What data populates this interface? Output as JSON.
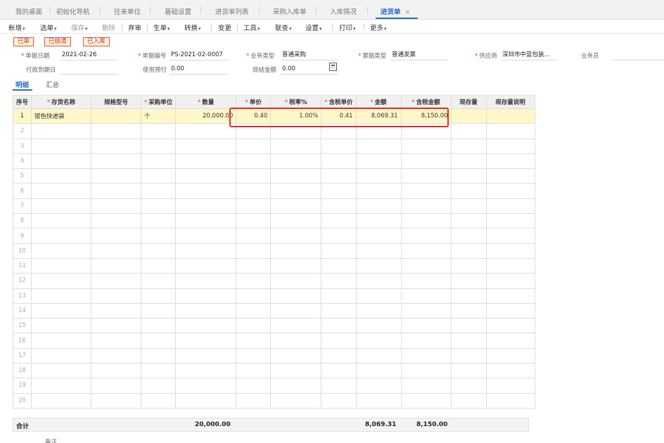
{
  "tabs": [
    {
      "label": "我的桌面"
    },
    {
      "label": "初始化导航"
    },
    {
      "label": "往来单位"
    },
    {
      "label": "基础设置"
    },
    {
      "label": "进货单列表"
    },
    {
      "label": "采购入库单"
    },
    {
      "label": "入库情况"
    },
    {
      "label": "进货单",
      "close": "×"
    }
  ],
  "toolbar": {
    "add": "新增",
    "select": "选单",
    "save": "保存",
    "delete": "删除",
    "discard": "弃审",
    "generate": "生单",
    "convert": "转换",
    "change": "变更",
    "tools": "工具",
    "query": "联查",
    "settings": "设置",
    "print": "打印",
    "more": "更多"
  },
  "status_badges": [
    "已审",
    "已结清",
    "已入库"
  ],
  "header": {
    "doc_date_label": "单据日期",
    "doc_date": "2021-02-26",
    "doc_no_label": "单据编号",
    "doc_no": "PS-2021-02-0007",
    "biz_type_label": "业务类型",
    "biz_type": "普通采购",
    "invoice_type_label": "票据类型",
    "invoice_type": "普通发票",
    "supplier_label": "供应商",
    "supplier": "深圳市中蓝包装...",
    "salesman_label": "业务员",
    "salesman": "",
    "due_date_label": "付款到期日",
    "due_date": "",
    "prepay_label": "使用预付",
    "prepay": "0.00",
    "cash_label": "现结金额",
    "cash": "0.00"
  },
  "subtabs": [
    "明细",
    "汇总"
  ],
  "grid": {
    "columns": [
      "序号",
      "存货名称",
      "规格型号",
      "采购单位",
      "数量",
      "单价",
      "税率%",
      "含税单价",
      "金额",
      "含税金额",
      "现存量",
      "现存量说明"
    ],
    "rows": [
      {
        "idx": "1",
        "name": "银色快递袋",
        "spec": "",
        "unit": "个",
        "qty": "20,000.00",
        "price": "0.40",
        "tax_rate": "1.00%",
        "tax_price": "0.41",
        "amount": "8,069.31",
        "tax_amount": "8,150.00",
        "stock": "",
        "stock_note": ""
      },
      {
        "idx": "2"
      },
      {
        "idx": "3"
      },
      {
        "idx": "4"
      },
      {
        "idx": "5"
      },
      {
        "idx": "6"
      },
      {
        "idx": "7"
      },
      {
        "idx": "8"
      },
      {
        "idx": "9"
      },
      {
        "idx": "10"
      },
      {
        "idx": "11"
      },
      {
        "idx": "12"
      },
      {
        "idx": "13"
      },
      {
        "idx": "14"
      },
      {
        "idx": "15"
      },
      {
        "idx": "16"
      },
      {
        "idx": "17"
      },
      {
        "idx": "18"
      },
      {
        "idx": "19"
      },
      {
        "idx": "20"
      }
    ]
  },
  "totals": {
    "label": "合计",
    "qty": "20,000.00",
    "amount": "8,069.31",
    "tax_amount": "8,150.00"
  },
  "remark_label": "备注"
}
